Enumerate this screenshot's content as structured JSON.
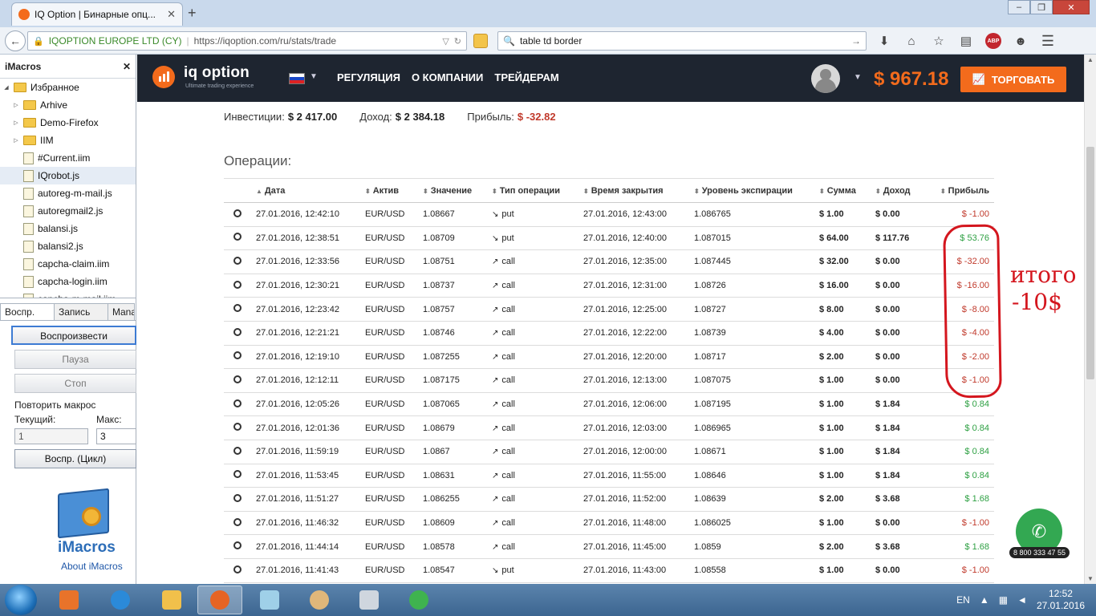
{
  "browser": {
    "tab_title": "IQ Option | Бинарные опц...",
    "url_org": "IQOPTION EUROPE LTD (CY)",
    "url": "https://iqoption.com/ru/stats/trade",
    "search_value": "table td border",
    "abp_label": "ABP"
  },
  "imacros": {
    "title": "iMacros",
    "tree": [
      {
        "label": "Избранное",
        "type": "folder",
        "level": 0,
        "expanded": true
      },
      {
        "label": "Arhive",
        "type": "folder",
        "level": 1
      },
      {
        "label": "Demo-Firefox",
        "type": "folder",
        "level": 1
      },
      {
        "label": "IIM",
        "type": "folder",
        "level": 1
      },
      {
        "label": "#Current.iim",
        "type": "file",
        "level": 1
      },
      {
        "label": "IQrobot.js",
        "type": "file",
        "level": 1,
        "selected": true
      },
      {
        "label": "autoreg-m-mail.js",
        "type": "file",
        "level": 1
      },
      {
        "label": "autoregmail2.js",
        "type": "file",
        "level": 1
      },
      {
        "label": "balansi.js",
        "type": "file",
        "level": 1
      },
      {
        "label": "balansi2.js",
        "type": "file",
        "level": 1
      },
      {
        "label": "capcha-claim.iim",
        "type": "file",
        "level": 1
      },
      {
        "label": "capcha-login.iim",
        "type": "file",
        "level": 1
      },
      {
        "label": "capcha-m-mail.iim",
        "type": "file",
        "level": 1
      }
    ],
    "tabs": [
      "Воспр.",
      "Запись",
      "Mana"
    ],
    "play_button": "Воспроизвести",
    "pause_button": "Пауза",
    "stop_button": "Стоп",
    "repeat_label": "Повторить макрос",
    "current_label": "Текущий:",
    "max_label": "Макс:",
    "current_value": "1",
    "max_value": "3",
    "loop_button": "Воспр. (Цикл)",
    "logo_text": "iMacros",
    "about_link": "About iMacros"
  },
  "site": {
    "brand": "iq option",
    "brand_sub": "Ultimate trading experience",
    "nav": [
      "РЕГУЛЯЦИЯ",
      "О КОМПАНИИ",
      "ТРЕЙДЕРАМ"
    ],
    "balance": "$ 967.18",
    "trade_button": "ТОРГОВАТЬ",
    "accent_color": "#f36b1c"
  },
  "summary": {
    "invest_label": "Инвестиции:",
    "invest_value": "$ 2 417.00",
    "income_label": "Доход:",
    "income_value": "$ 2 384.18",
    "profit_label": "Прибыль:",
    "profit_value": "$ -32.82"
  },
  "operations": {
    "title": "Операции:",
    "headers": [
      "Дата",
      "Актив",
      "Значение",
      "Тип операции",
      "Время закрытия",
      "Уровень экспирации",
      "Сумма",
      "Доход",
      "Прибыль"
    ],
    "rows": [
      {
        "date": "27.01.2016, 12:42:10",
        "asset": "EUR/USD",
        "value": "1.08667",
        "type": "put",
        "close": "27.01.2016, 12:43:00",
        "exp": "1.086765",
        "amount": "$ 1.00",
        "income": "$ 0.00",
        "profit": "$ -1.00"
      },
      {
        "date": "27.01.2016, 12:38:51",
        "asset": "EUR/USD",
        "value": "1.08709",
        "type": "put",
        "close": "27.01.2016, 12:40:00",
        "exp": "1.087015",
        "amount": "$ 64.00",
        "income": "$ 117.76",
        "profit": "$ 53.76"
      },
      {
        "date": "27.01.2016, 12:33:56",
        "asset": "EUR/USD",
        "value": "1.08751",
        "type": "call",
        "close": "27.01.2016, 12:35:00",
        "exp": "1.087445",
        "amount": "$ 32.00",
        "income": "$ 0.00",
        "profit": "$ -32.00"
      },
      {
        "date": "27.01.2016, 12:30:21",
        "asset": "EUR/USD",
        "value": "1.08737",
        "type": "call",
        "close": "27.01.2016, 12:31:00",
        "exp": "1.08726",
        "amount": "$ 16.00",
        "income": "$ 0.00",
        "profit": "$ -16.00"
      },
      {
        "date": "27.01.2016, 12:23:42",
        "asset": "EUR/USD",
        "value": "1.08757",
        "type": "call",
        "close": "27.01.2016, 12:25:00",
        "exp": "1.08727",
        "amount": "$ 8.00",
        "income": "$ 0.00",
        "profit": "$ -8.00"
      },
      {
        "date": "27.01.2016, 12:21:21",
        "asset": "EUR/USD",
        "value": "1.08746",
        "type": "call",
        "close": "27.01.2016, 12:22:00",
        "exp": "1.08739",
        "amount": "$ 4.00",
        "income": "$ 0.00",
        "profit": "$ -4.00"
      },
      {
        "date": "27.01.2016, 12:19:10",
        "asset": "EUR/USD",
        "value": "1.087255",
        "type": "call",
        "close": "27.01.2016, 12:20:00",
        "exp": "1.08717",
        "amount": "$ 2.00",
        "income": "$ 0.00",
        "profit": "$ -2.00"
      },
      {
        "date": "27.01.2016, 12:12:11",
        "asset": "EUR/USD",
        "value": "1.087175",
        "type": "call",
        "close": "27.01.2016, 12:13:00",
        "exp": "1.087075",
        "amount": "$ 1.00",
        "income": "$ 0.00",
        "profit": "$ -1.00"
      },
      {
        "date": "27.01.2016, 12:05:26",
        "asset": "EUR/USD",
        "value": "1.087065",
        "type": "call",
        "close": "27.01.2016, 12:06:00",
        "exp": "1.087195",
        "amount": "$ 1.00",
        "income": "$ 1.84",
        "profit": "$ 0.84"
      },
      {
        "date": "27.01.2016, 12:01:36",
        "asset": "EUR/USD",
        "value": "1.08679",
        "type": "call",
        "close": "27.01.2016, 12:03:00",
        "exp": "1.086965",
        "amount": "$ 1.00",
        "income": "$ 1.84",
        "profit": "$ 0.84"
      },
      {
        "date": "27.01.2016, 11:59:19",
        "asset": "EUR/USD",
        "value": "1.0867",
        "type": "call",
        "close": "27.01.2016, 12:00:00",
        "exp": "1.08671",
        "amount": "$ 1.00",
        "income": "$ 1.84",
        "profit": "$ 0.84"
      },
      {
        "date": "27.01.2016, 11:53:45",
        "asset": "EUR/USD",
        "value": "1.08631",
        "type": "call",
        "close": "27.01.2016, 11:55:00",
        "exp": "1.08646",
        "amount": "$ 1.00",
        "income": "$ 1.84",
        "profit": "$ 0.84"
      },
      {
        "date": "27.01.2016, 11:51:27",
        "asset": "EUR/USD",
        "value": "1.086255",
        "type": "call",
        "close": "27.01.2016, 11:52:00",
        "exp": "1.08639",
        "amount": "$ 2.00",
        "income": "$ 3.68",
        "profit": "$ 1.68"
      },
      {
        "date": "27.01.2016, 11:46:32",
        "asset": "EUR/USD",
        "value": "1.08609",
        "type": "call",
        "close": "27.01.2016, 11:48:00",
        "exp": "1.086025",
        "amount": "$ 1.00",
        "income": "$ 0.00",
        "profit": "$ -1.00"
      },
      {
        "date": "27.01.2016, 11:44:14",
        "asset": "EUR/USD",
        "value": "1.08578",
        "type": "call",
        "close": "27.01.2016, 11:45:00",
        "exp": "1.0859",
        "amount": "$ 2.00",
        "income": "$ 3.68",
        "profit": "$ 1.68"
      },
      {
        "date": "27.01.2016, 11:41:43",
        "asset": "EUR/USD",
        "value": "1.08547",
        "type": "put",
        "close": "27.01.2016, 11:43:00",
        "exp": "1.08558",
        "amount": "$ 1.00",
        "income": "$ 0.00",
        "profit": "$ -1.00"
      }
    ]
  },
  "annotation": {
    "line1": "итого",
    "line2": "-10$"
  },
  "callback": {
    "phone": "8 800 333 47 55"
  },
  "taskbar": {
    "lang": "EN",
    "time": "12:52",
    "date": "27.01.2016"
  }
}
